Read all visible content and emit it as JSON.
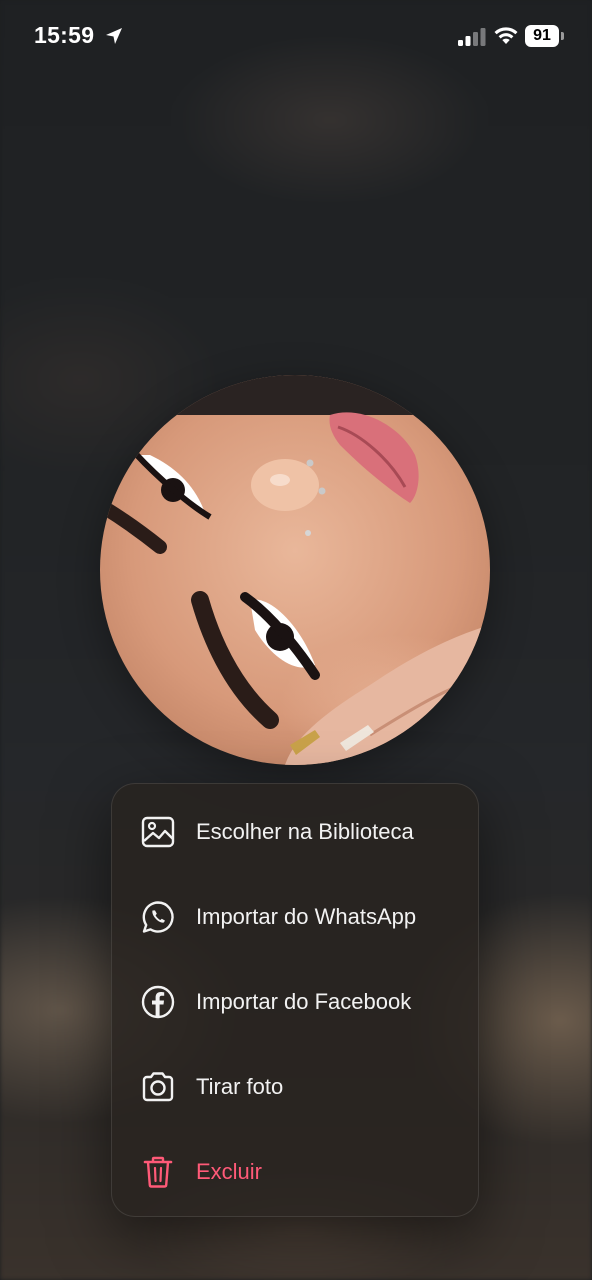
{
  "status_bar": {
    "time": "15:59",
    "battery": "91",
    "icons": [
      "location-arrow-icon",
      "cellular-signal-icon",
      "wifi-icon",
      "battery-icon"
    ]
  },
  "avatar": {
    "description_icon": "profile-photo"
  },
  "menu": {
    "items": [
      {
        "label": "Escolher na Biblioteca",
        "icon": "photo-library-icon"
      },
      {
        "label": "Importar do WhatsApp",
        "icon": "whatsapp-icon"
      },
      {
        "label": "Importar do Facebook",
        "icon": "facebook-icon"
      },
      {
        "label": "Tirar foto",
        "icon": "camera-icon"
      },
      {
        "label": "Excluir",
        "icon": "trash-icon",
        "destructive": true
      }
    ]
  },
  "colors": {
    "menu_text": "#f2f2f2",
    "destructive": "#ff5a78",
    "background": "#1c1e20"
  }
}
